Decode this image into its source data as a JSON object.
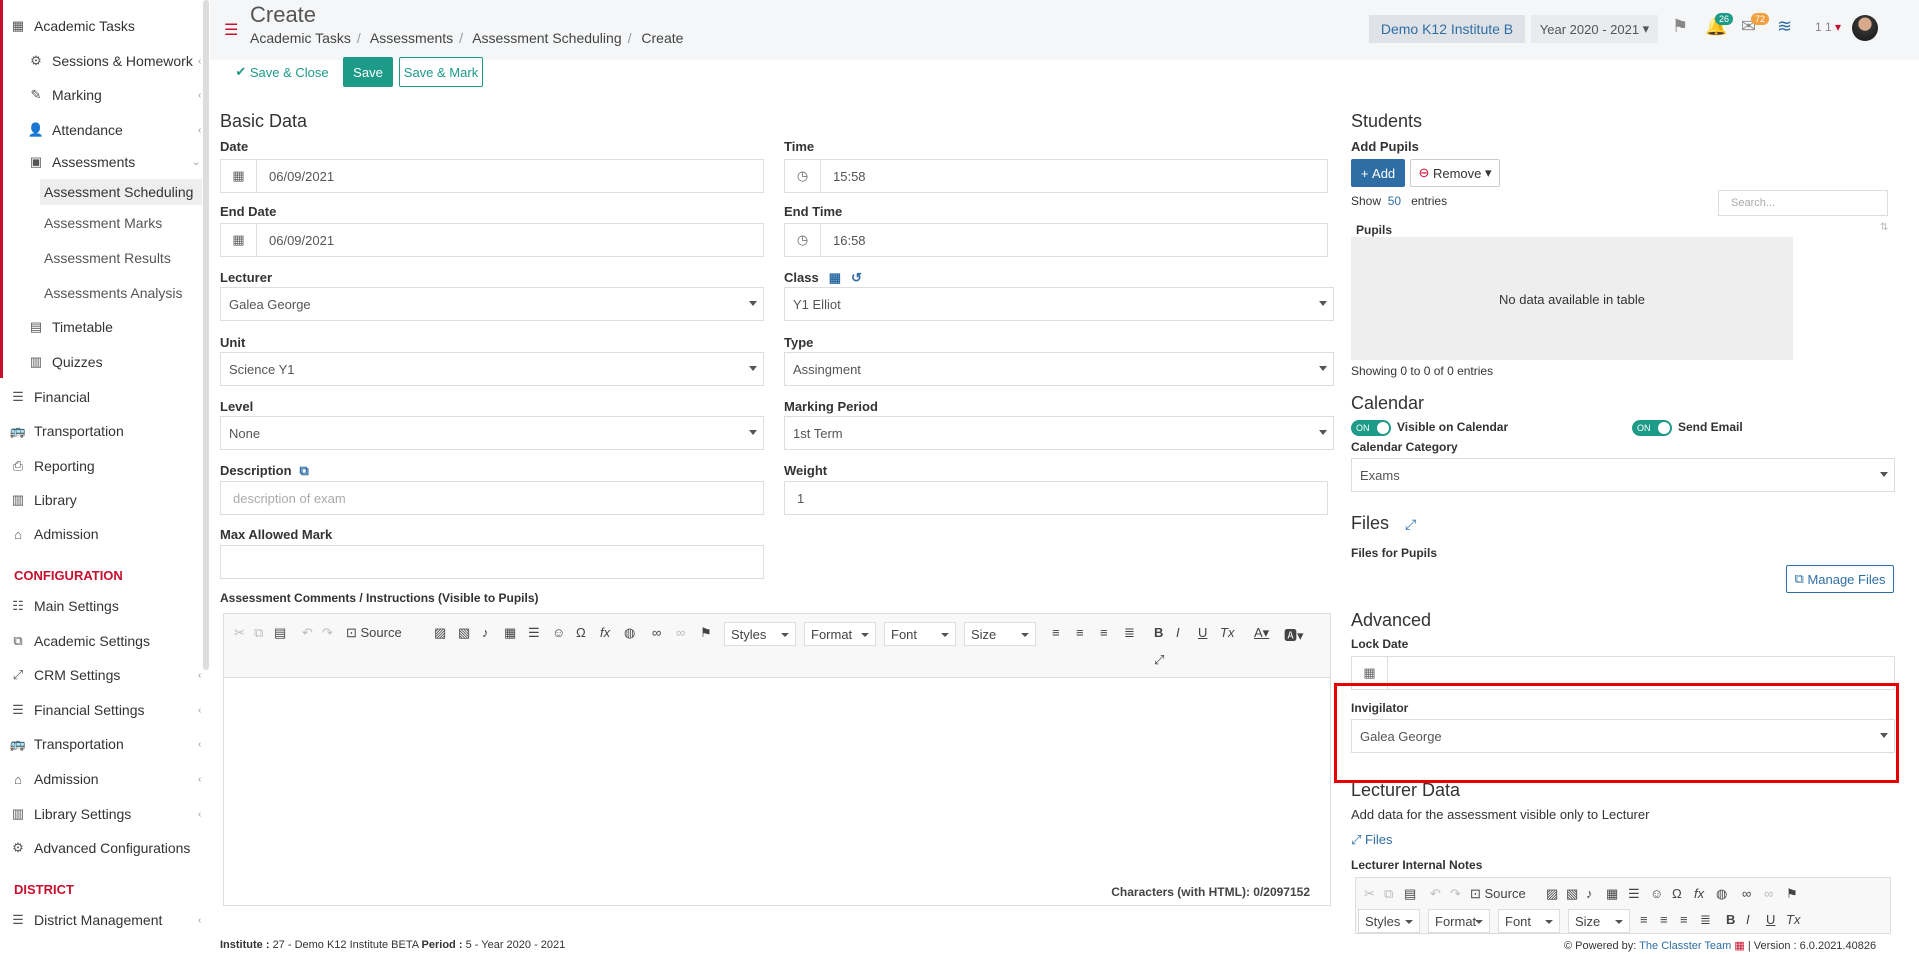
{
  "sidebar": {
    "items": [
      {
        "label": "Academic Tasks",
        "icon": "grid-icon"
      },
      {
        "label": "Sessions & Homework",
        "icon": "sessions-icon"
      },
      {
        "label": "Marking",
        "icon": "edit-icon"
      },
      {
        "label": "Attendance",
        "icon": "user-icon"
      },
      {
        "label": "Assessments",
        "icon": "assessment-icon"
      },
      {
        "label": "Assessment Scheduling"
      },
      {
        "label": "Assessment Marks"
      },
      {
        "label": "Assessment Results"
      },
      {
        "label": "Assessments Analysis"
      },
      {
        "label": "Timetable",
        "icon": "calendar-icon"
      },
      {
        "label": "Quizzes",
        "icon": "quiz-icon"
      },
      {
        "label": "Financial",
        "icon": "database-icon"
      },
      {
        "label": "Transportation",
        "icon": "bus-icon"
      },
      {
        "label": "Reporting",
        "icon": "print-icon"
      },
      {
        "label": "Library",
        "icon": "library-icon"
      },
      {
        "label": "Admission",
        "icon": "bank-icon"
      }
    ],
    "config_heading": "CONFIGURATION",
    "config_items": [
      {
        "label": "Main Settings"
      },
      {
        "label": "Academic Settings"
      },
      {
        "label": "CRM Settings"
      },
      {
        "label": "Financial Settings"
      },
      {
        "label": "Transportation"
      },
      {
        "label": "Admission"
      },
      {
        "label": "Library Settings"
      },
      {
        "label": "Advanced Configurations"
      }
    ],
    "district_heading": "DISTRICT",
    "district_items": [
      {
        "label": "District Management"
      }
    ]
  },
  "header": {
    "title": "Create",
    "breadcrumbs": [
      "Academic Tasks",
      "Assessments",
      "Assessment Scheduling",
      "Create"
    ],
    "institute": "Demo K12 Institute B",
    "year": "Year 2020 - 2021",
    "notif_count": "26",
    "mail_count": "72",
    "user_short": "1 1"
  },
  "actions": {
    "save_close": "Save & Close",
    "save": "Save",
    "save_mark": "Save & Mark"
  },
  "basic": {
    "heading": "Basic Data",
    "date_label": "Date",
    "date": "06/09/2021",
    "time_label": "Time",
    "time": "15:58",
    "end_date_label": "End Date",
    "end_date": "06/09/2021",
    "end_time_label": "End Time",
    "end_time": "16:58",
    "lecturer_label": "Lecturer",
    "lecturer": "Galea George",
    "class_label": "Class",
    "class": "Y1 Elliot",
    "unit_label": "Unit",
    "unit": "Science Y1",
    "type_label": "Type",
    "type": "Assingment",
    "level_label": "Level",
    "level": "None",
    "period_label": "Marking Period",
    "period": "1st Term",
    "desc_label": "Description",
    "desc_placeholder": "description of exam",
    "weight_label": "Weight",
    "weight": "1",
    "max_label": "Max Allowed Mark",
    "comments_label": "Assessment Comments / Instructions (Visible to Pupils)"
  },
  "editor": {
    "source": "Source",
    "styles": "Styles",
    "format": "Format",
    "font": "Font",
    "size": "Size",
    "chars": "Characters (with HTML): 0/2097152"
  },
  "students": {
    "heading": "Students",
    "add_pupils": "Add Pupils",
    "add": "Add",
    "remove": "Remove",
    "show": "Show",
    "entries_count": "50",
    "entries": "entries",
    "search_placeholder": "Search...",
    "col_pupils": "Pupils",
    "no_data": "No data available in table",
    "showing": "Showing 0 to 0 of 0 entries"
  },
  "calendar": {
    "heading": "Calendar",
    "on": "ON",
    "visible": "Visible on Calendar",
    "send_email": "Send Email",
    "category_label": "Calendar Category",
    "category": "Exams"
  },
  "files": {
    "heading": "Files",
    "for_pupils": "Files for Pupils",
    "manage": "Manage Files"
  },
  "advanced": {
    "heading": "Advanced",
    "lock_date": "Lock Date",
    "invigilator_label": "Invigilator",
    "invigilator": "Galea George"
  },
  "lecturer_data": {
    "heading": "Lecturer Data",
    "desc": "Add data for the assessment visible only to Lecturer",
    "files": "Files",
    "notes": "Lecturer Internal Notes"
  },
  "footer": {
    "institute_label": "Institute :",
    "institute": "27 - Demo K12 Institute BETA",
    "period_label": "Period :",
    "period": "5 - Year 2020 - 2021",
    "powered": "Powered by:",
    "team": "The Classter Team",
    "version": "Version : 6.0.2021.40826"
  }
}
